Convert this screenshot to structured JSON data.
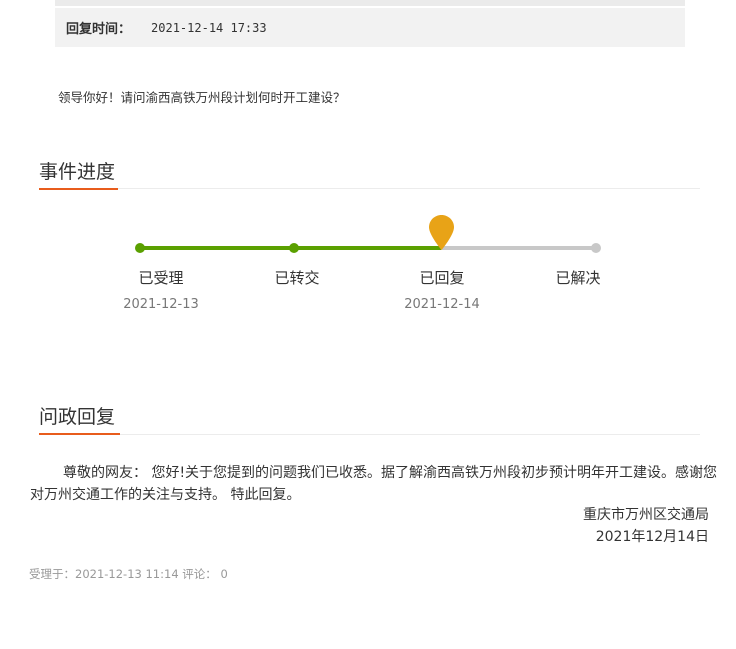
{
  "reply_time": {
    "label": "回复时间：",
    "value": "2021-12-14 17:33"
  },
  "question": "领导你好！请问渝西高铁万州段计划何时开工建设？",
  "progress": {
    "title": "事件进度",
    "current_step_index": 2,
    "steps": [
      {
        "label": "已受理",
        "date": "2021-12-13",
        "status": "done"
      },
      {
        "label": "已转交",
        "date": "",
        "status": "done"
      },
      {
        "label": "已回复",
        "date": "2021-12-14",
        "status": "current"
      },
      {
        "label": "已解决",
        "date": "",
        "status": "pending"
      }
    ],
    "colors": {
      "done": "#5aa000",
      "pending": "#c8c8c8",
      "marker": "#e8a317"
    }
  },
  "reply": {
    "title": "问政回复",
    "body": "尊敬的网友： 您好!关于您提到的问题我们已收悉。据了解渝西高铁万州段初步预计明年开工建设。感谢您对万州交通工作的关注与支持。 特此回复。",
    "signature": "重庆市万州区交通局",
    "date": "2021年12月14日"
  },
  "footer": {
    "accepted_label": "受理于：",
    "accepted_time": "2021-12-13 11:14",
    "comments_label": "评论：",
    "comments_count": "0"
  },
  "accent_color": "#e85c1c"
}
